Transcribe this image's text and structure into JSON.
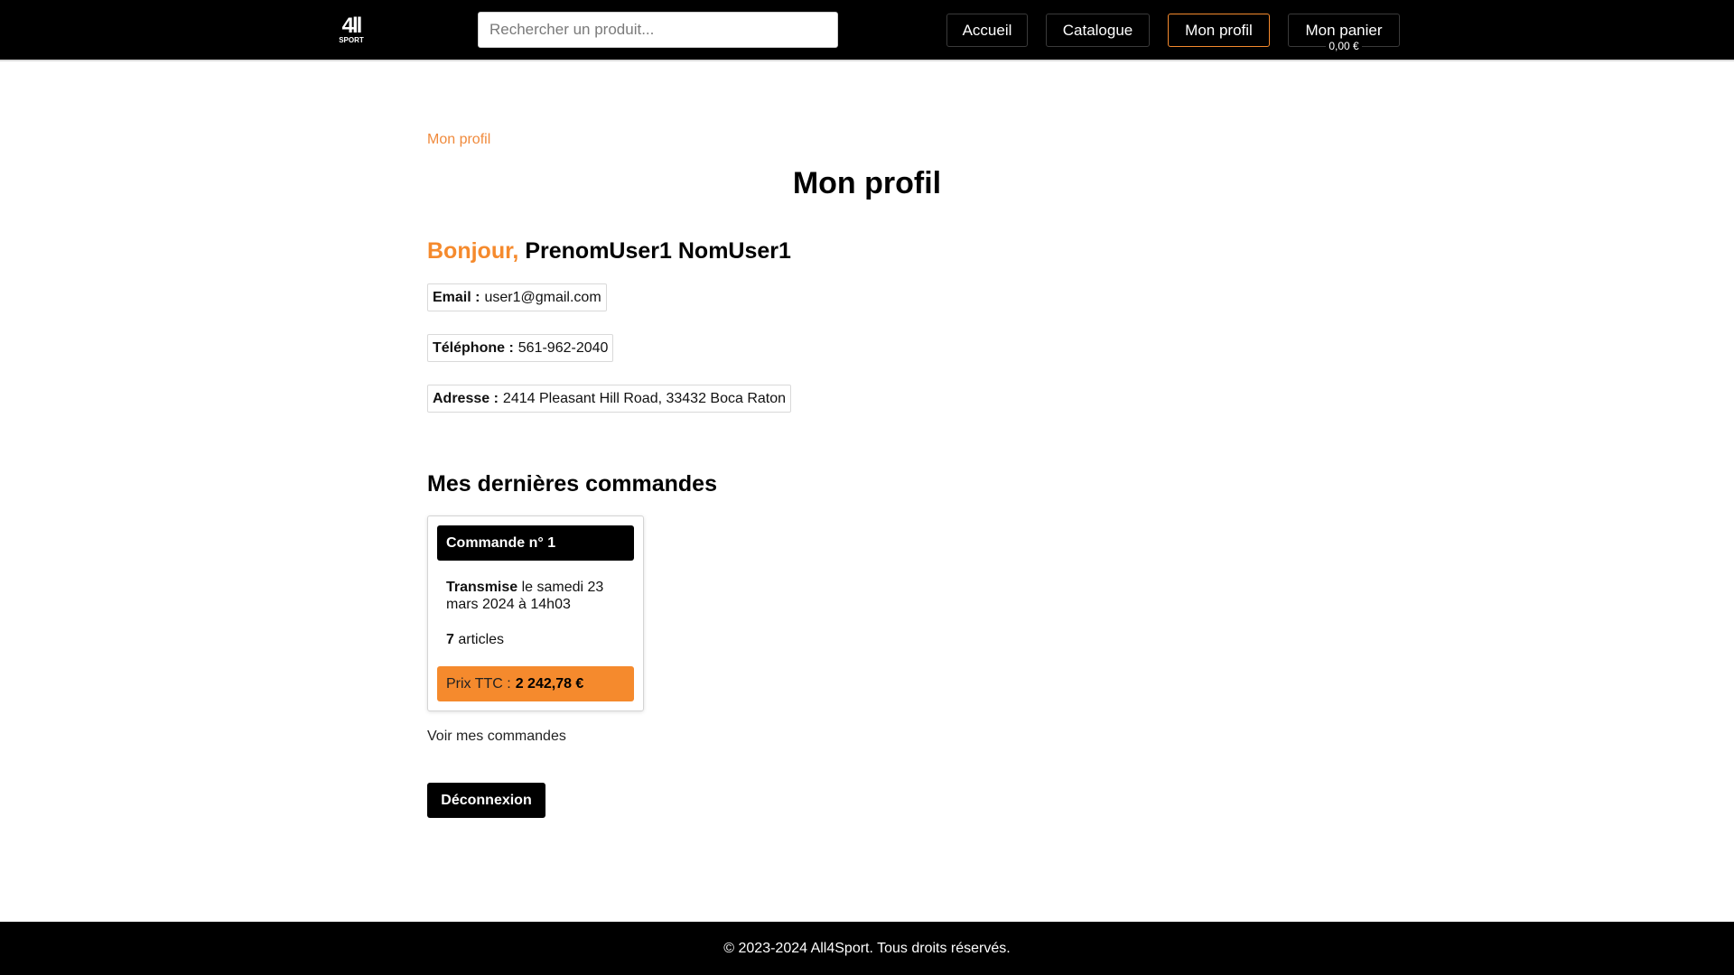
{
  "header": {
    "logo_top": "4ll",
    "logo_bottom": "SPORT",
    "search_placeholder": "Rechercher un produit...",
    "nav": {
      "home": "Accueil",
      "catalog": "Catalogue",
      "profile": "Mon profil",
      "cart": "Mon panier",
      "cart_total": "0,00 €"
    }
  },
  "breadcrumb": "Mon profil",
  "page_title": "Mon profil",
  "greeting": {
    "hello": "Bonjour,",
    "name": "PrenomUser1 NomUser1"
  },
  "profile": {
    "email_label": "Email :",
    "email": "user1@gmail.com",
    "phone_label": "Téléphone :",
    "phone": "561-962-2040",
    "address_label": "Adresse :",
    "address": "2414 Pleasant Hill Road, 33432 Boca Raton"
  },
  "orders": {
    "title": "Mes dernières commandes",
    "items": [
      {
        "header": "Commande n° 1",
        "status": "Transmise",
        "date": "le samedi 23 mars 2024 à 14h03",
        "count": "7",
        "count_label": "articles",
        "price_label": "Prix TTC :",
        "price": "2 242,78 €"
      }
    ],
    "view_all": "Voir mes commandes"
  },
  "logout_label": "Déconnexion",
  "footer": "© 2023-2024 All4Sport. Tous droits réservés.",
  "colors": {
    "accent": "#f58a2d",
    "header_bg": "#000000"
  }
}
